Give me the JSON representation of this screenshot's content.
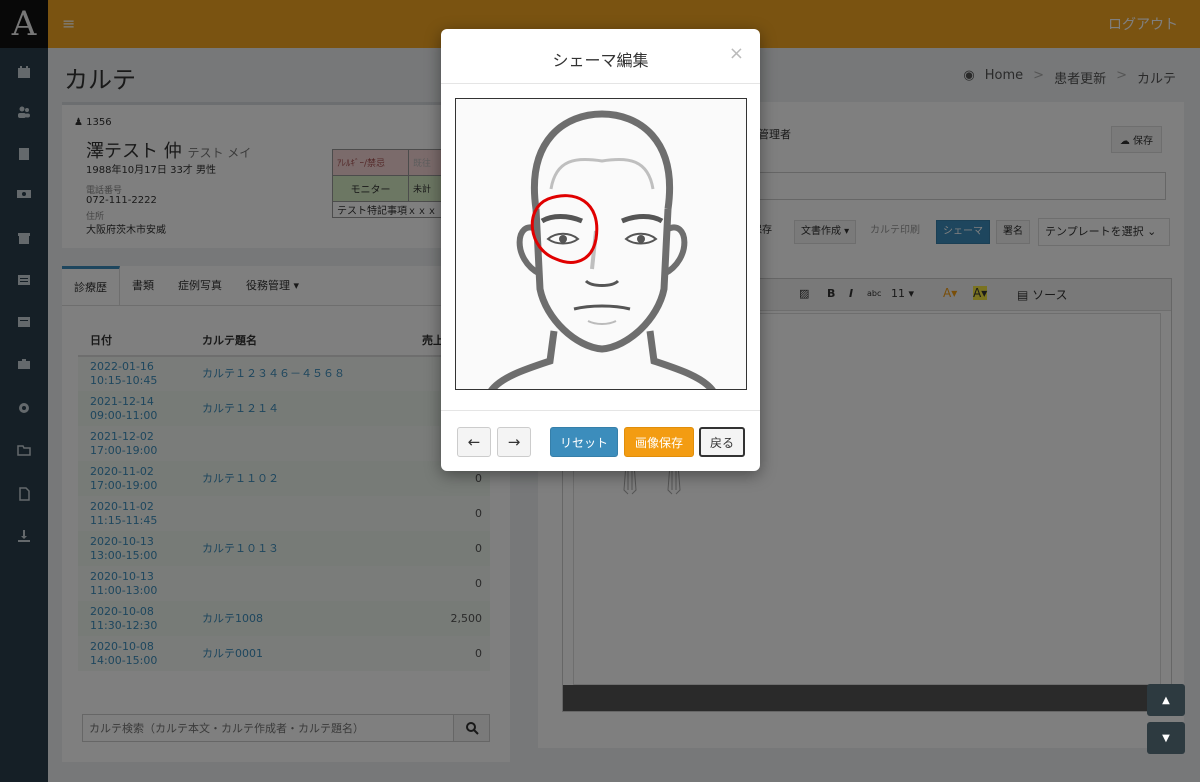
{
  "app": {
    "logo": "A",
    "logout": "ログアウト"
  },
  "sidebar": {
    "icons": [
      "calendar-icon",
      "users-icon",
      "book-icon",
      "money-icon",
      "archive-icon",
      "list-icon",
      "table-icon",
      "briefcase-icon",
      "gear-icon",
      "folder-icon",
      "document-icon",
      "download-icon"
    ]
  },
  "page": {
    "title": "カルテ",
    "breadcrumb": [
      "Home",
      "患者更新",
      "カルテ"
    ]
  },
  "patient": {
    "id": "1356",
    "name": "澤テスト 仲",
    "kana": "テスト メイ",
    "birth": "1988年10月17日 33才 男性",
    "phone_label": "電話番号",
    "phone": "072-111-2222",
    "address_label": "住所",
    "address": "大阪府茨木市安威",
    "allergy_label": "ｱﾚﾙｷﾞｰ/禁忌",
    "cell2": "既往",
    "monitor": "モニター",
    "cell4": "未計",
    "note": "テスト特記事項ｘｘｘ"
  },
  "tabs": [
    {
      "label": "診療歴"
    },
    {
      "label": "書類"
    },
    {
      "label": "症例写真"
    },
    {
      "label": "役務管理 ▾"
    }
  ],
  "history": {
    "headers": [
      "日付",
      "カルテ題名",
      "売上"
    ],
    "rows": [
      {
        "date": "2022-01-16",
        "time": "10:15-10:45",
        "title": "カルテ１２３４６－４５６８",
        "amount": ""
      },
      {
        "date": "2021-12-14",
        "time": "09:00-11:00",
        "title": "カルテ１２１４",
        "amount": ""
      },
      {
        "date": "2021-12-02",
        "time": "17:00-19:00",
        "title": "",
        "amount": ""
      },
      {
        "date": "2020-11-02",
        "time": "17:00-19:00",
        "title": "カルテ１１０２",
        "amount": "0"
      },
      {
        "date": "2020-11-02",
        "time": "11:15-11:45",
        "title": "",
        "amount": "0"
      },
      {
        "date": "2020-10-13",
        "time": "13:00-15:00",
        "title": "カルテ１０１３",
        "amount": "0"
      },
      {
        "date": "2020-10-13",
        "time": "11:00-13:00",
        "title": "",
        "amount": "0"
      },
      {
        "date": "2020-10-08",
        "time": "11:30-12:30",
        "title": "カルテ1008",
        "amount": "2,500"
      },
      {
        "date": "2020-10-08",
        "time": "14:00-15:00",
        "title": "カルテ0001",
        "amount": "0"
      }
    ],
    "search_placeholder": "カルテ検索（カルテ本文・カルテ作成者・カルテ題名）"
  },
  "editor": {
    "author": "管理者",
    "save": "保存",
    "buttons": {
      "temp_save": "保存",
      "doc_create": "文書作成 ▾",
      "print": "カルテ印刷",
      "schema": "シェーマ",
      "sign": "署名",
      "template": "テンプレートを選択"
    },
    "toolbar": {
      "font_size": "11",
      "source": "ソース"
    }
  },
  "modal": {
    "title": "シェーマ編集",
    "close": "×",
    "undo": "←",
    "redo": "→",
    "reset": "リセット",
    "image_save": "画像保存",
    "back": "戻る"
  },
  "scroll": {
    "up": "▲",
    "down": "▼"
  },
  "colors": {
    "topbar": "#f5a623",
    "sidebar": "#2a3f4d",
    "primary": "#3c8dbc",
    "warning": "#f39c12",
    "annotation": "#e00000"
  }
}
